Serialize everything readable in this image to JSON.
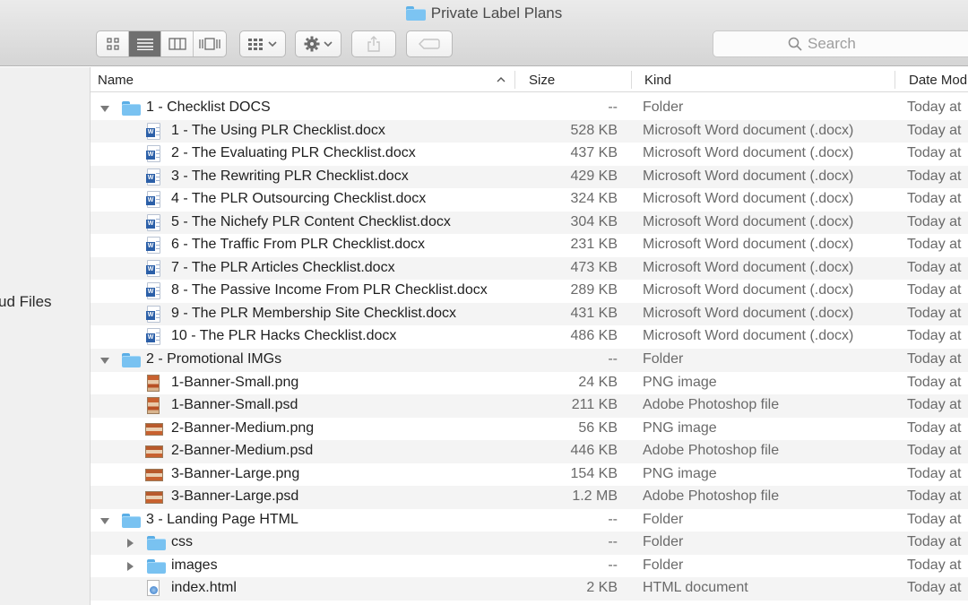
{
  "window": {
    "title": "Private Label Plans"
  },
  "toolbar": {
    "view_modes": [
      "icon-view",
      "list-view",
      "column-view",
      "cover-flow-view"
    ],
    "active_view": "list-view",
    "search_placeholder": "Search"
  },
  "sidebar": {
    "partial_item_label": "ud Files"
  },
  "columns": {
    "name": "Name",
    "size": "Size",
    "kind": "Kind",
    "date": "Date Mod"
  },
  "rows": [
    {
      "level": 0,
      "type": "folder",
      "expanded": true,
      "name": "1 - Checklist DOCS",
      "size": "--",
      "kind": "Folder",
      "date": "Today at"
    },
    {
      "level": 1,
      "type": "word",
      "name": "1 - The Using PLR Checklist.docx",
      "size": "528 KB",
      "kind": "Microsoft Word document (.docx)",
      "date": "Today at"
    },
    {
      "level": 1,
      "type": "word",
      "name": "2 - The Evaluating PLR Checklist.docx",
      "size": "437 KB",
      "kind": "Microsoft Word document (.docx)",
      "date": "Today at"
    },
    {
      "level": 1,
      "type": "word",
      "name": "3 - The Rewriting PLR Checklist.docx",
      "size": "429 KB",
      "kind": "Microsoft Word document (.docx)",
      "date": "Today at"
    },
    {
      "level": 1,
      "type": "word",
      "name": "4 - The PLR Outsourcing Checklist.docx",
      "size": "324 KB",
      "kind": "Microsoft Word document (.docx)",
      "date": "Today at"
    },
    {
      "level": 1,
      "type": "word",
      "name": "5 - The Nichefy PLR Content Checklist.docx",
      "size": "304 KB",
      "kind": "Microsoft Word document (.docx)",
      "date": "Today at"
    },
    {
      "level": 1,
      "type": "word",
      "name": "6 - The Traffic From PLR Checklist.docx",
      "size": "231 KB",
      "kind": "Microsoft Word document (.docx)",
      "date": "Today at"
    },
    {
      "level": 1,
      "type": "word",
      "name": "7 - The PLR Articles Checklist.docx",
      "size": "473 KB",
      "kind": "Microsoft Word document (.docx)",
      "date": "Today at"
    },
    {
      "level": 1,
      "type": "word",
      "name": "8 - The Passive Income From PLR Checklist.docx",
      "size": "289 KB",
      "kind": "Microsoft Word document (.docx)",
      "date": "Today at"
    },
    {
      "level": 1,
      "type": "word",
      "name": "9 - The PLR Membership Site Checklist.docx",
      "size": "431 KB",
      "kind": "Microsoft Word document (.docx)",
      "date": "Today at"
    },
    {
      "level": 1,
      "type": "word",
      "name": "10 - The PLR Hacks Checklist.docx",
      "size": "486 KB",
      "kind": "Microsoft Word document (.docx)",
      "date": "Today at"
    },
    {
      "level": 0,
      "type": "folder",
      "expanded": true,
      "name": "2 - Promotional IMGs",
      "size": "--",
      "kind": "Folder",
      "date": "Today at"
    },
    {
      "level": 1,
      "type": "img-tall",
      "name": "1-Banner-Small.png",
      "size": "24 KB",
      "kind": "PNG image",
      "date": "Today at"
    },
    {
      "level": 1,
      "type": "img-tall",
      "name": "1-Banner-Small.psd",
      "size": "211 KB",
      "kind": "Adobe Photoshop file",
      "date": "Today at"
    },
    {
      "level": 1,
      "type": "img-wide",
      "name": "2-Banner-Medium.png",
      "size": "56 KB",
      "kind": "PNG image",
      "date": "Today at"
    },
    {
      "level": 1,
      "type": "img-wide",
      "name": "2-Banner-Medium.psd",
      "size": "446 KB",
      "kind": "Adobe Photoshop file",
      "date": "Today at"
    },
    {
      "level": 1,
      "type": "img-wide",
      "name": "3-Banner-Large.png",
      "size": "154 KB",
      "kind": "PNG image",
      "date": "Today at"
    },
    {
      "level": 1,
      "type": "img-wide",
      "name": "3-Banner-Large.psd",
      "size": "1.2 MB",
      "kind": "Adobe Photoshop file",
      "date": "Today at"
    },
    {
      "level": 0,
      "type": "folder",
      "expanded": true,
      "name": "3 - Landing Page HTML",
      "size": "--",
      "kind": "Folder",
      "date": "Today at"
    },
    {
      "level": 1,
      "type": "folder",
      "expanded": false,
      "name": "css",
      "size": "--",
      "kind": "Folder",
      "date": "Today at"
    },
    {
      "level": 1,
      "type": "folder",
      "expanded": false,
      "name": "images",
      "size": "--",
      "kind": "Folder",
      "date": "Today at"
    },
    {
      "level": 1,
      "type": "html",
      "name": "index.html",
      "size": "2 KB",
      "kind": "HTML document",
      "date": "Today at"
    }
  ]
}
